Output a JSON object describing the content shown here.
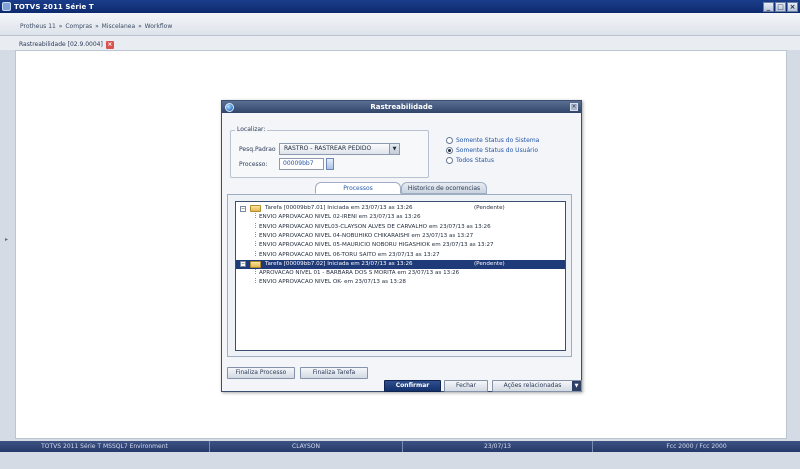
{
  "window": {
    "title": "TOTVS 2011 Série T",
    "min_label": "_",
    "max_label": "□",
    "close_label": "×"
  },
  "breadcrumb": [
    "Protheus 11",
    "»",
    "Compras",
    "»",
    "Miscelanea",
    "»",
    "Workflow"
  ],
  "doc_tab": {
    "label": "Rastreabilidade [02.9.0004]",
    "close": "×"
  },
  "dialog": {
    "title": "Rastreabilidade",
    "close": "×",
    "localizar": {
      "legend": "Localizar:",
      "pesq_label": "Pesq.Padrao",
      "pesq_value": "RASTRO - RASTREAR PEDIDO",
      "processo_label": "Processo:",
      "processo_value": "00009bb7"
    },
    "radios": [
      {
        "label": "Somente Status do Sistema",
        "checked": false
      },
      {
        "label": "Somente Status do Usuário",
        "checked": true
      },
      {
        "label": "Todos Status",
        "checked": false
      }
    ],
    "tabs": [
      {
        "label": "Processos",
        "active": true
      },
      {
        "label": "Historico de ocorrencias",
        "active": false
      }
    ],
    "tree": [
      {
        "level": 0,
        "expander": "−",
        "folder": true,
        "text": "Tarefa [00009bb7.01] Iniciada em 23/07/13 as 13:26",
        "status": "(Pendente)",
        "selected": false
      },
      {
        "level": 1,
        "text": "ENVIO APROVACAO NIVEL 02-IRENI em 23/07/13 as 13:26"
      },
      {
        "level": 1,
        "text": "ENVIO APROVACAO NIVEL03-CLAYSON ALVES DE CARVALHO em 23/07/13 as 13:26"
      },
      {
        "level": 1,
        "text": "ENVIO APROVACAO NIVEL 04-NOBUHIKO  CHIKARAISHI em 23/07/13 as 13:27"
      },
      {
        "level": 1,
        "text": "ENVIO APROVACAO NIVEL 05-MAURICIO NOBORU HIGASHIOK em 23/07/13 as 13:27"
      },
      {
        "level": 1,
        "text": "ENVIO APROVACAO NIVEL 06-TORU SAITO em 23/07/13 as 13:27"
      },
      {
        "level": 0,
        "expander": "−",
        "folder": true,
        "text": "Tarefa [00009bb7.02] Iniciada em 23/07/13 as 13:26",
        "status": "(Pendente)",
        "selected": true
      },
      {
        "level": 1,
        "text": "APROVACAO NIVEL 01 - BARBARA DOS S MORITA em 23/07/13 as 13:26"
      },
      {
        "level": 1,
        "text": "ENVIO APROVACAO NIVEL OK- em 23/07/13 as 13:28"
      }
    ],
    "buttons": {
      "finaliza_processo": "Finaliza Processo",
      "finaliza_tarefa": "Finaliza Tarefa",
      "confirmar": "Confirmar",
      "fechar": "Fechar",
      "acoes": "Ações relacionadas",
      "acoes_arrow": "▼"
    }
  },
  "statusbar": [
    "TOTVS 2011 Série T  MSSQL7 Environment",
    "CLAYSON",
    "23/07/13",
    "Fcc 2000 / Fcc 2000"
  ],
  "colors": {
    "titlebar": "#0e2a6e",
    "selection": "#1f3a78",
    "statusbar": "#26396a",
    "primary_button": "#13306a"
  }
}
